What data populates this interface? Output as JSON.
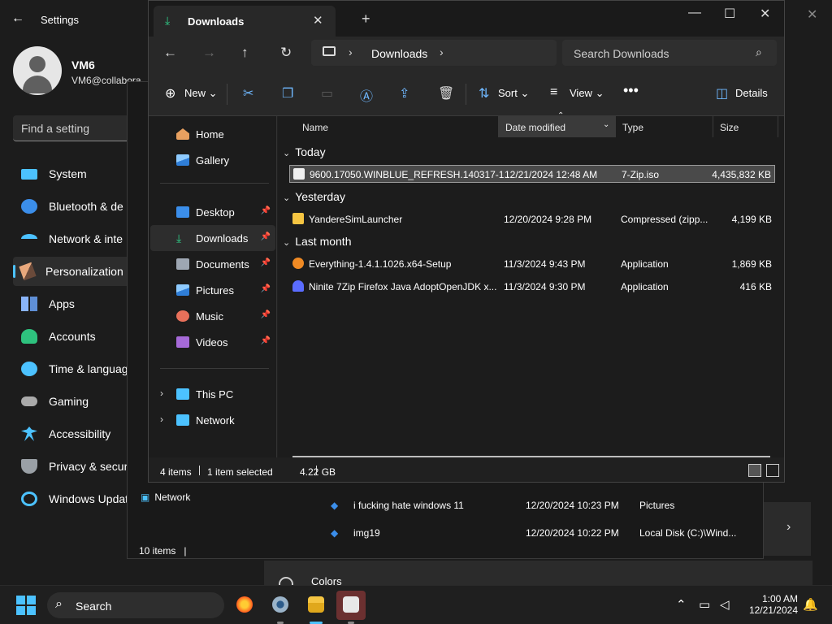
{
  "settings": {
    "title": "Settings",
    "user": {
      "name": "VM6",
      "email": "VM6@collabora"
    },
    "find_placeholder": "Find a setting",
    "nav": [
      {
        "label": "System",
        "icon": "monitor-icon",
        "color": "#4cc2ff"
      },
      {
        "label": "Bluetooth & de",
        "icon": "bluetooth-icon",
        "color": "#3b8eea"
      },
      {
        "label": "Network & inte",
        "icon": "wifi-icon",
        "color": "#4cc2ff"
      },
      {
        "label": "Personalization",
        "icon": "brush-icon",
        "color": "#e8a87c"
      },
      {
        "label": "Apps",
        "icon": "apps-icon",
        "color": "#8ab4f8"
      },
      {
        "label": "Accounts",
        "icon": "person-icon",
        "color": "#2ec27e"
      },
      {
        "label": "Time & languag",
        "icon": "clock-globe-icon",
        "color": "#4cc2ff"
      },
      {
        "label": "Gaming",
        "icon": "gamepad-icon",
        "color": "#aaaaaa"
      },
      {
        "label": "Accessibility",
        "icon": "accessibility-icon",
        "color": "#4cc2ff"
      },
      {
        "label": "Privacy & secur",
        "icon": "shield-icon",
        "color": "#9aa0a6"
      },
      {
        "label": "Windows Updat",
        "icon": "update-icon",
        "color": "#4cc2ff"
      }
    ],
    "colors_label": "Colors"
  },
  "explorer2": {
    "nav_network": "Network",
    "rows": [
      {
        "name": "i fucking hate windows 11",
        "date": "12/20/2024 10:23 PM",
        "type": "Pictures"
      },
      {
        "name": "img19",
        "date": "12/20/2024 10:22 PM",
        "type": "Local Disk (C:)\\Wind..."
      }
    ],
    "status": "10 items"
  },
  "explorer": {
    "tab_title": "Downloads",
    "breadcrumb": "Downloads",
    "search_placeholder": "Search Downloads",
    "toolbar": {
      "new": "New",
      "sort": "Sort",
      "view": "View",
      "details": "Details"
    },
    "sidebar": {
      "home": "Home",
      "gallery": "Gallery",
      "desktop": "Desktop",
      "downloads": "Downloads",
      "documents": "Documents",
      "pictures": "Pictures",
      "music": "Music",
      "videos": "Videos",
      "thispc": "This PC",
      "network": "Network"
    },
    "columns": {
      "name": "Name",
      "date": "Date modified",
      "type": "Type",
      "size": "Size"
    },
    "groups": {
      "today": "Today",
      "yesterday": "Yesterday",
      "lastmonth": "Last month"
    },
    "files": [
      {
        "name": "9600.17050.WINBLUE_REFRESH.140317-1...",
        "date": "12/21/2024 12:48 AM",
        "type": "7-Zip.iso",
        "size": "4,435,832 KB"
      },
      {
        "name": "YandereSimLauncher",
        "date": "12/20/2024 9:28 PM",
        "type": "Compressed (zipp...",
        "size": "4,199 KB"
      },
      {
        "name": "Everything-1.4.1.1026.x64-Setup",
        "date": "11/3/2024 9:43 PM",
        "type": "Application",
        "size": "1,869 KB"
      },
      {
        "name": "Ninite 7Zip Firefox Java AdoptOpenJDK x...",
        "date": "11/3/2024 9:30 PM",
        "type": "Application",
        "size": "416 KB"
      }
    ],
    "status": {
      "count": "4 items",
      "selected": "1 item selected",
      "size": "4.22 GB"
    }
  },
  "taskbar": {
    "search_label": "Search",
    "time": "1:00 AM",
    "date": "12/21/2024"
  }
}
